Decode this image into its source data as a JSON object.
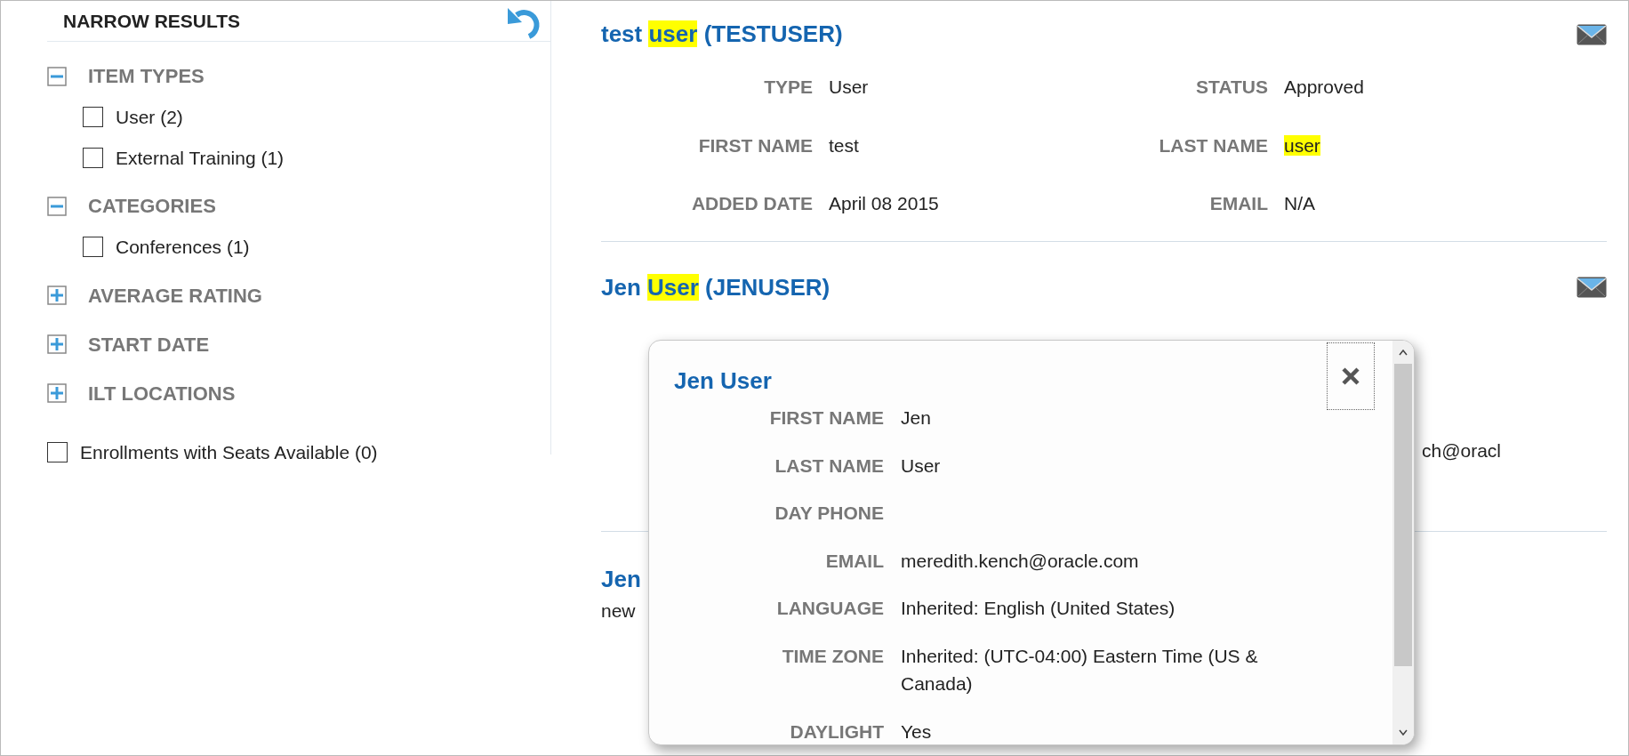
{
  "sidebar": {
    "title": "NARROW RESULTS",
    "groups": [
      {
        "label": "ITEM TYPES",
        "expanded": true,
        "options": [
          {
            "label": "User (2)",
            "checked": false
          },
          {
            "label": "External Training (1)",
            "checked": false
          }
        ]
      },
      {
        "label": "CATEGORIES",
        "expanded": true,
        "options": [
          {
            "label": "Conferences (1)",
            "checked": false
          }
        ]
      },
      {
        "label": "AVERAGE RATING",
        "expanded": false
      },
      {
        "label": "START DATE",
        "expanded": false
      },
      {
        "label": "ILT LOCATIONS",
        "expanded": false
      }
    ],
    "extra_option": {
      "label": "Enrollments with Seats Available (0)",
      "checked": false
    }
  },
  "results": [
    {
      "title": [
        {
          "text": "test",
          "highlighted": false
        },
        {
          "text": "user",
          "highlighted": true
        },
        {
          "text": "(TESTUSER)",
          "highlighted": false
        }
      ],
      "fields": [
        {
          "label": "TYPE",
          "value": "User",
          "highlighted": false
        },
        {
          "label": "STATUS",
          "value": "Approved",
          "highlighted": false
        },
        {
          "label": "FIRST NAME",
          "value": "test",
          "highlighted": false
        },
        {
          "label": "LAST NAME",
          "value": "user",
          "highlighted": true
        },
        {
          "label": "ADDED DATE",
          "value": "April 08 2015",
          "highlighted": false
        },
        {
          "label": "EMAIL",
          "value": "N/A",
          "highlighted": false
        }
      ]
    },
    {
      "title": [
        {
          "text": "Jen",
          "highlighted": false
        },
        {
          "text": "User",
          "highlighted": true
        },
        {
          "text": "(JENUSER)",
          "highlighted": false
        }
      ],
      "visible_fragment": "ch@oracl"
    },
    {
      "title": [
        {
          "text": "Jen",
          "highlighted": false
        }
      ],
      "description": "new"
    }
  ],
  "popup": {
    "title": "Jen User",
    "fields": [
      {
        "label": "FIRST NAME",
        "value": "Jen"
      },
      {
        "label": "LAST NAME",
        "value": "User"
      },
      {
        "label": "DAY PHONE"
      },
      {
        "label": "EMAIL",
        "value": "meredith.kench@oracle.com"
      },
      {
        "label": "LANGUAGE",
        "value": "Inherited: English (United States)"
      },
      {
        "label": "TIME ZONE",
        "value": "Inherited: (UTC-04:00) Eastern Time (US & Canada)"
      },
      {
        "label": "DAYLIGHT",
        "value": "Yes"
      }
    ]
  }
}
